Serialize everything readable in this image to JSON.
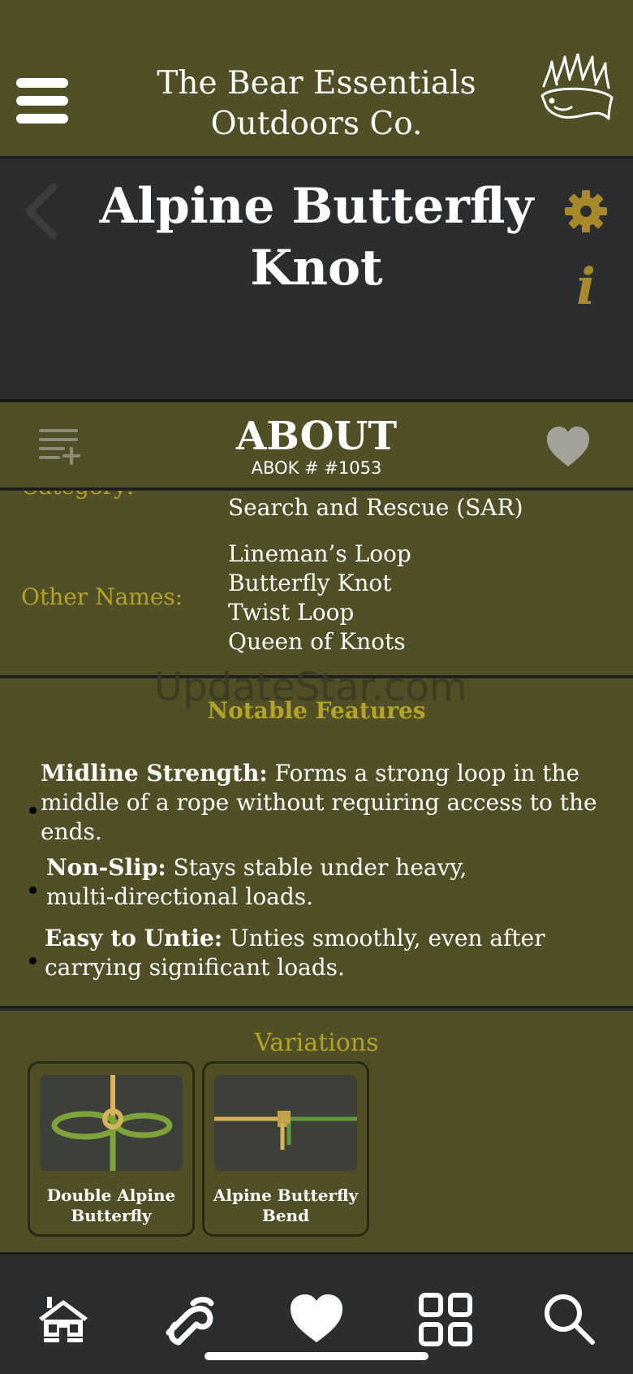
{
  "header": {
    "brand_line1": "The Bear Essentials",
    "brand_line2": "Outdoors Co.",
    "menu_icon": "hamburger-menu-icon",
    "logo_icon": "bear-paw-icon"
  },
  "title_band": {
    "title_line1": "Alpine Butterfly",
    "title_line2": "Knot",
    "back_icon": "chevron-left-icon",
    "settings_icon": "gear-icon",
    "info_glyph": "i"
  },
  "about_bar": {
    "title": "ABOUT",
    "abok": "ABOK # #1053",
    "list_icon": "playlist-add-icon",
    "favorite_icon": "heart-icon"
  },
  "details": {
    "category_label": "Category:",
    "category_value": "Search and Rescue (SAR)",
    "other_names_label": "Other Names:",
    "other_names": [
      "Lineman’s Loop",
      "Butterfly Knot",
      "Twist Loop",
      "Queen of Knots"
    ]
  },
  "watermark": "UpdateStar.com",
  "features": {
    "title": "Notable Features",
    "items": [
      {
        "name": "Midline Strength:",
        "text": " Forms a strong loop in the middle of a rope without requiring access to the ends."
      },
      {
        "name": "Non-Slip:",
        "text": " Stays stable under heavy, multi-directional loads."
      },
      {
        "name": "Easy to Untie:",
        "text": " Unties smoothly, even after carrying significant loads."
      }
    ]
  },
  "variations": {
    "title": "Variations",
    "cards": [
      {
        "label": "Double Alpine Butterfly"
      },
      {
        "label": "Alpine Butterfly Bend"
      }
    ]
  },
  "bottom_nav": {
    "items": [
      "home-cabin-icon",
      "rope-knot-icon",
      "heart-icon",
      "grid-icon",
      "search-icon"
    ]
  },
  "colors": {
    "olive": "#514f26",
    "dark": "#2c2d2f",
    "gold": "#b3a329",
    "gear": "#a8892a"
  }
}
